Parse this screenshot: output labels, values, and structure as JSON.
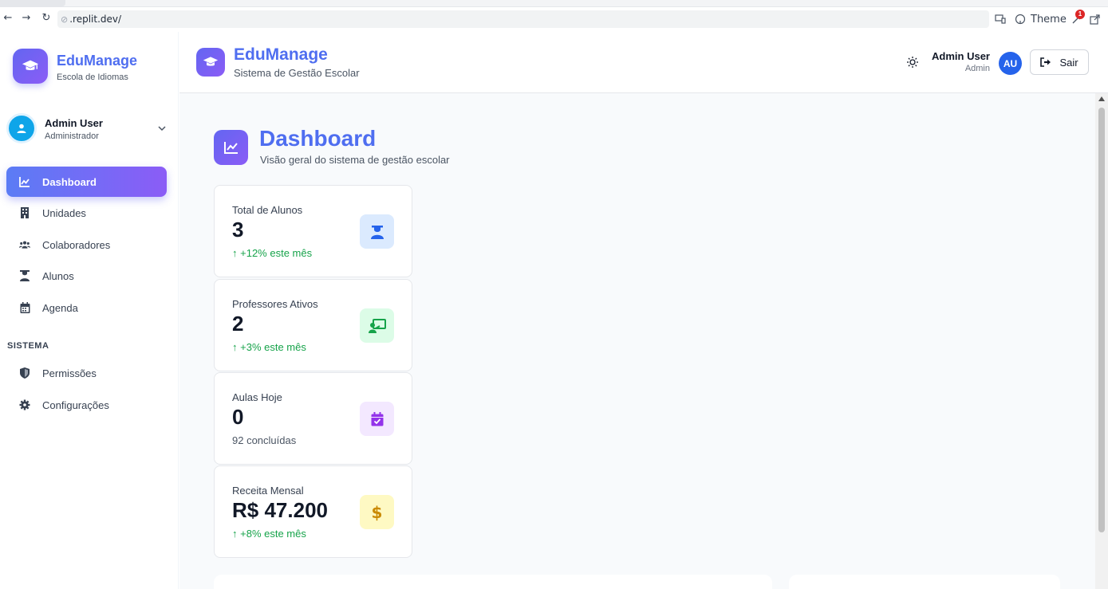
{
  "browser": {
    "url": ".replit.dev/",
    "theme_label": "Theme",
    "notification_count": "1"
  },
  "sidebar": {
    "brand_title": "EduManage",
    "brand_subtitle": "Escola de Idiomas",
    "user": {
      "name": "Admin User",
      "role": "Administrador"
    },
    "items": [
      {
        "label": "Dashboard",
        "icon": "chart-line-icon",
        "active": true
      },
      {
        "label": "Unidades",
        "icon": "building-icon"
      },
      {
        "label": "Colaboradores",
        "icon": "users-icon"
      },
      {
        "label": "Alunos",
        "icon": "student-icon"
      },
      {
        "label": "Agenda",
        "icon": "calendar-icon"
      }
    ],
    "section_label": "SISTEMA",
    "system_items": [
      {
        "label": "Permissões",
        "icon": "shield-icon"
      },
      {
        "label": "Configurações",
        "icon": "gear-icon"
      }
    ]
  },
  "header": {
    "title": "EduManage",
    "subtitle": "Sistema de Gestão Escolar",
    "user_name": "Admin User",
    "user_role": "Admin",
    "avatar_initials": "AU",
    "logout_label": "Sair"
  },
  "dashboard": {
    "title": "Dashboard",
    "subtitle": "Visão geral do sistema de gestão escolar",
    "stats": [
      {
        "label": "Total de Alunos",
        "value": "3",
        "trend": "+12% este mês",
        "icon": "graduate-icon",
        "icon_bg": "#dbeafe",
        "icon_color": "#2563eb"
      },
      {
        "label": "Professores Ativos",
        "value": "2",
        "trend": "+3% este mês",
        "icon": "teacher-icon",
        "icon_bg": "#dcfce7",
        "icon_color": "#16a34a"
      },
      {
        "label": "Aulas Hoje",
        "value": "0",
        "trend": "92 concluídas",
        "icon": "calendar-check-icon",
        "icon_bg": "#f3e8ff",
        "icon_color": "#9333ea"
      },
      {
        "label": "Receita Mensal",
        "value": "R$ 47.200",
        "trend": "+8% este mês",
        "icon": "dollar-icon",
        "icon_bg": "#fef9c3",
        "icon_color": "#ca8a04"
      }
    ]
  },
  "colors": {
    "brand": "#4f6ef0",
    "accent_gradient_start": "#5b7cf5",
    "accent_gradient_end": "#8b5cf6",
    "positive": "#16a34a"
  }
}
